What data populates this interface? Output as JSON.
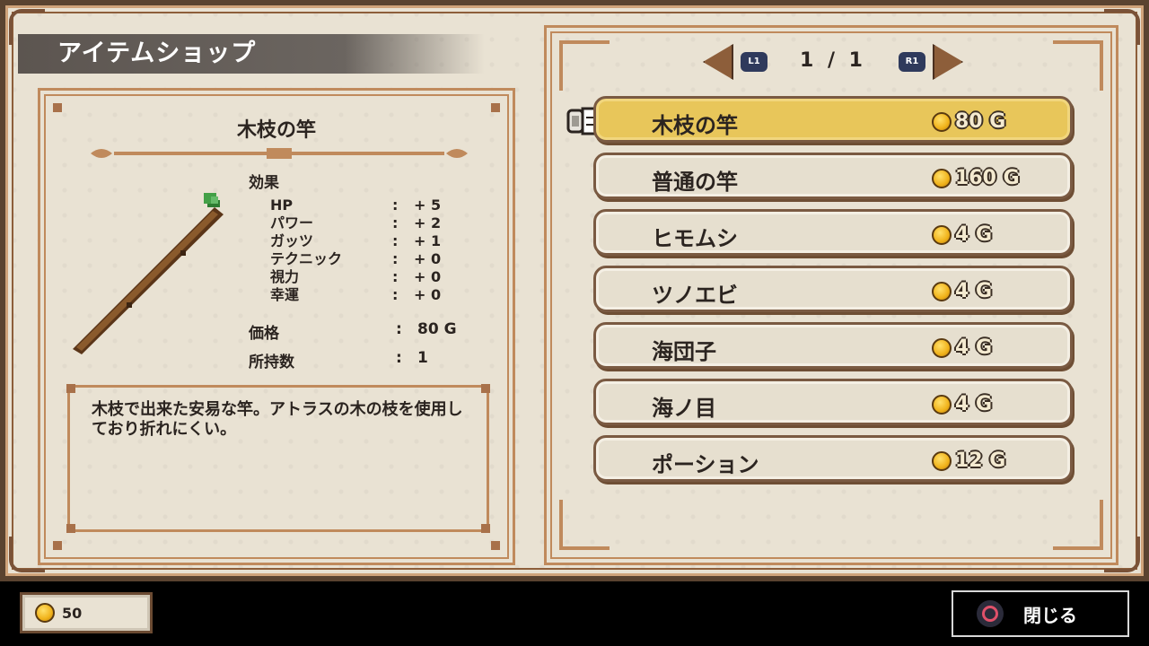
{
  "title": "アイテムショップ",
  "detail": {
    "item_name": "木枝の竿",
    "effects_label": "効果",
    "stats": [
      {
        "name": "HP",
        "value": "+ 5"
      },
      {
        "name": "パワー",
        "value": "+ 2"
      },
      {
        "name": "ガッツ",
        "value": "+ 1"
      },
      {
        "name": "テクニック",
        "value": "+ 0"
      },
      {
        "name": "視力",
        "value": "+ 0"
      },
      {
        "name": "幸運",
        "value": "+ 0"
      }
    ],
    "price_label": "価格",
    "price_value": "80 G",
    "owned_label": "所持数",
    "owned_value": "1",
    "description": "木枝で出来た安易な竿。アトラスの木の枝を使用しており折れにくい。"
  },
  "pager": {
    "left_badge": "L1",
    "right_badge": "R1",
    "page_text": "1 / 1"
  },
  "shop_items": [
    {
      "name": "木枝の竿",
      "price": "80 G",
      "selected": true
    },
    {
      "name": "普通の竿",
      "price": "160 G",
      "selected": false
    },
    {
      "name": "ヒモムシ",
      "price": "4 G",
      "selected": false
    },
    {
      "name": "ツノエビ",
      "price": "4 G",
      "selected": false
    },
    {
      "name": "海団子",
      "price": "4 G",
      "selected": false
    },
    {
      "name": "海ノ目",
      "price": "4 G",
      "selected": false
    },
    {
      "name": "ポーション",
      "price": "12 G",
      "selected": false
    }
  ],
  "wallet": {
    "gold": "50"
  },
  "close_button": {
    "label": "閉じる"
  },
  "icons": {
    "coin": "coin-icon",
    "cursor": "pointing-hand-icon",
    "item": "wooden-rod-icon",
    "close": "circle-button-icon"
  },
  "colors": {
    "parchment": "#e9e2d3",
    "frame_brown": "#c08a5c",
    "selected_row": "#e8c65a",
    "title_banner": "#5c5550"
  }
}
